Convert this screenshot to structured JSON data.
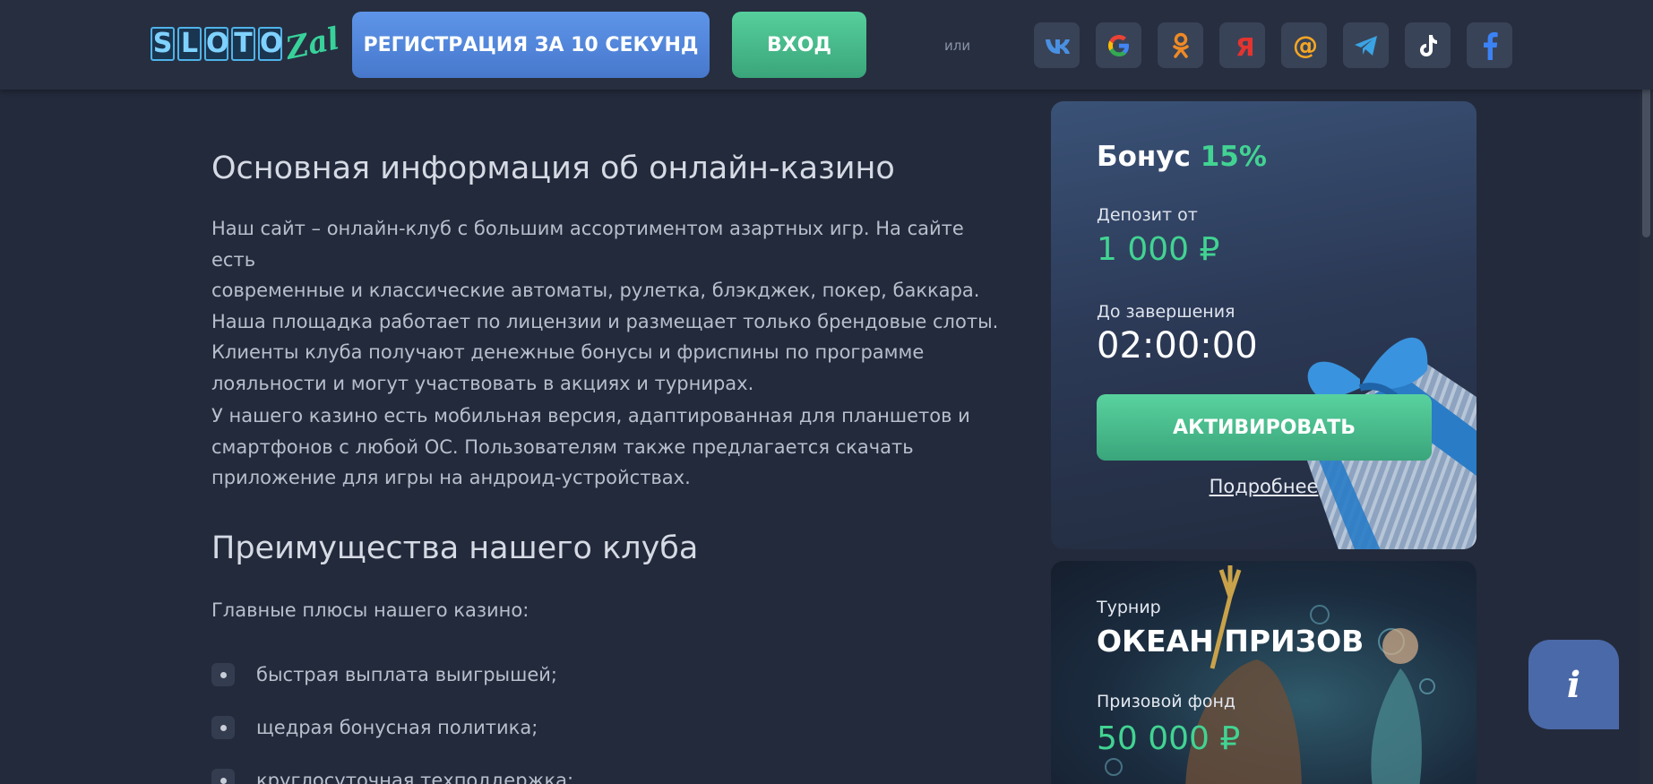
{
  "header": {
    "logo_main": [
      "S",
      "L",
      "O",
      "T",
      "O"
    ],
    "logo_script": "Zal",
    "register_label": "РЕГИСТРАЦИЯ ЗА 10 СЕКУНД",
    "login_label": "ВХОД",
    "or_text": "или",
    "socials": [
      {
        "name": "vk-icon",
        "glyph": "вк",
        "color": "#4a90e2"
      },
      {
        "name": "google-icon",
        "glyph": "G",
        "color": "#ea4335"
      },
      {
        "name": "odnoklassniki-icon",
        "glyph": "ок",
        "color": "#f08a24"
      },
      {
        "name": "yandex-icon",
        "glyph": "Я",
        "color": "#e3342f"
      },
      {
        "name": "mailru-icon",
        "glyph": "@",
        "color": "#f5a623"
      },
      {
        "name": "telegram-icon",
        "glyph": "tg",
        "color": "#3aa3e3"
      },
      {
        "name": "tiktok-icon",
        "glyph": "tt",
        "color": "#ffffff"
      },
      {
        "name": "facebook-icon",
        "glyph": "f",
        "color": "#3b82f6"
      }
    ]
  },
  "main": {
    "heading1": "Основная информация об онлайн-казино",
    "para1": [
      "Наш сайт – онлайн-клуб с большим ассортиментом азартных игр. На сайте есть",
      "современные и классические автоматы, рулетка, блэкджек, покер, баккара.",
      "Наша площадка работает по лицензии и размещает только брендовые слоты.",
      "Клиенты клуба получают денежные бонусы и фриспины по программе",
      "лояльности и могут участвовать в акциях и турнирах."
    ],
    "para2": [
      "У нашего казино есть мобильная версия, адаптированная для планшетов и",
      "смартфонов с любой ОС. Пользователям также предлагается скачать",
      "приложение для игры на андроид-устройствах."
    ],
    "heading2": "Преимущества нашего клуба",
    "intro": "Главные плюсы нашего казино:",
    "list": [
      "быстрая выплата выигрышей;",
      "щедрая бонусная политика;",
      "круглосуточная техподдержка;"
    ]
  },
  "bonus": {
    "title": "Бонус",
    "percent": "15%",
    "deposit_label": "Депозит от",
    "deposit_value": "1 000 ₽",
    "timer_label": "До завершения",
    "timer_value": "02:00:00",
    "activate_label": "АКТИВИРОВАТЬ",
    "more_label": "Подробнее"
  },
  "tournament": {
    "label": "Турнир",
    "title": "ОКЕАН ПРИЗОВ",
    "fund_label": "Призовой фонд",
    "fund_value": "50 000 ₽"
  },
  "info_button": "i",
  "colors": {
    "background": "#232a3b",
    "header": "#262e40",
    "accent_green": "#42d392",
    "accent_blue": "#4a78cc"
  }
}
